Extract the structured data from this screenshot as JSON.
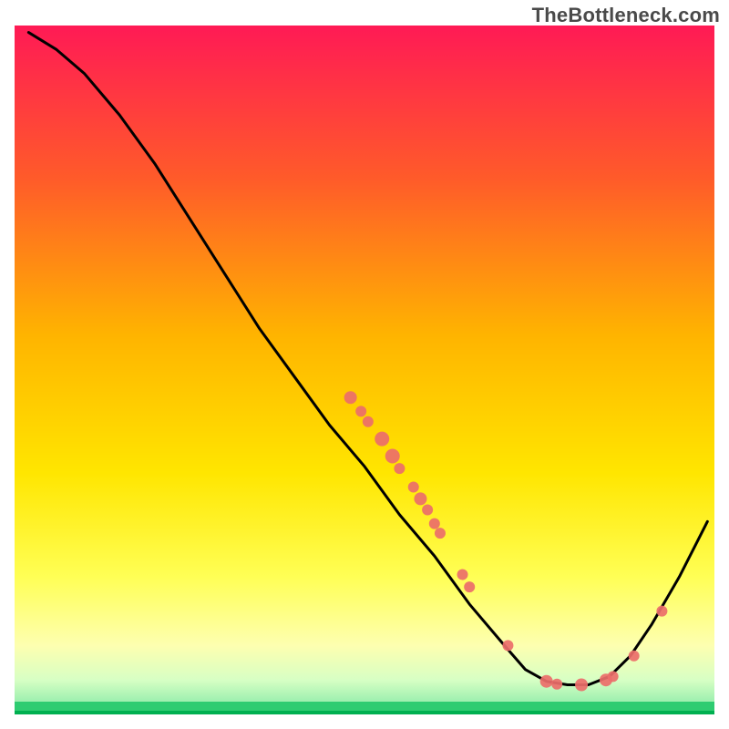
{
  "watermark": "TheBottleneck.com",
  "chart_data": {
    "type": "line",
    "title": "",
    "xlabel": "",
    "ylabel": "",
    "xlim": [
      0,
      100
    ],
    "ylim": [
      0,
      100
    ],
    "background_gradient": {
      "top": "#ff1a55",
      "mid1": "#ff7a00",
      "mid2": "#ffd400",
      "mid3": "#ffff55",
      "mid4": "#e8ffbf",
      "bottom_band": "#2ecc71",
      "bottom_line": "#00b050"
    },
    "curve": [
      {
        "x": 2.0,
        "y": 99.0
      },
      {
        "x": 6.0,
        "y": 96.5
      },
      {
        "x": 10.0,
        "y": 93.0
      },
      {
        "x": 15.0,
        "y": 87.0
      },
      {
        "x": 20.0,
        "y": 80.0
      },
      {
        "x": 25.0,
        "y": 72.0
      },
      {
        "x": 30.0,
        "y": 64.0
      },
      {
        "x": 35.0,
        "y": 56.0
      },
      {
        "x": 40.0,
        "y": 49.0
      },
      {
        "x": 45.0,
        "y": 42.0
      },
      {
        "x": 50.0,
        "y": 36.0
      },
      {
        "x": 55.0,
        "y": 29.0
      },
      {
        "x": 60.0,
        "y": 23.0
      },
      {
        "x": 65.0,
        "y": 16.0
      },
      {
        "x": 70.0,
        "y": 10.0
      },
      {
        "x": 73.0,
        "y": 6.5
      },
      {
        "x": 76.0,
        "y": 4.8
      },
      {
        "x": 79.0,
        "y": 4.3
      },
      {
        "x": 82.0,
        "y": 4.3
      },
      {
        "x": 85.0,
        "y": 5.5
      },
      {
        "x": 88.0,
        "y": 8.5
      },
      {
        "x": 91.0,
        "y": 13.0
      },
      {
        "x": 95.0,
        "y": 20.0
      },
      {
        "x": 99.0,
        "y": 28.0
      }
    ],
    "points": [
      {
        "x": 48.0,
        "y": 46.0,
        "r": 7
      },
      {
        "x": 49.5,
        "y": 44.0,
        "r": 6
      },
      {
        "x": 50.5,
        "y": 42.5,
        "r": 6
      },
      {
        "x": 52.5,
        "y": 40.0,
        "r": 8
      },
      {
        "x": 54.0,
        "y": 37.5,
        "r": 8
      },
      {
        "x": 55.0,
        "y": 35.7,
        "r": 6
      },
      {
        "x": 57.0,
        "y": 33.0,
        "r": 6
      },
      {
        "x": 58.0,
        "y": 31.3,
        "r": 7
      },
      {
        "x": 59.0,
        "y": 29.7,
        "r": 6
      },
      {
        "x": 60.0,
        "y": 27.7,
        "r": 6
      },
      {
        "x": 60.8,
        "y": 26.3,
        "r": 6
      },
      {
        "x": 64.0,
        "y": 20.3,
        "r": 6
      },
      {
        "x": 65.0,
        "y": 18.5,
        "r": 6
      },
      {
        "x": 70.5,
        "y": 10.0,
        "r": 6
      },
      {
        "x": 76.0,
        "y": 4.8,
        "r": 7
      },
      {
        "x": 77.5,
        "y": 4.4,
        "r": 6
      },
      {
        "x": 81.0,
        "y": 4.3,
        "r": 7
      },
      {
        "x": 84.5,
        "y": 5.0,
        "r": 7
      },
      {
        "x": 85.5,
        "y": 5.5,
        "r": 6
      },
      {
        "x": 88.5,
        "y": 8.5,
        "r": 6
      },
      {
        "x": 92.5,
        "y": 15.0,
        "r": 6
      }
    ],
    "point_color": "#ec6e6a",
    "curve_color": "#000000",
    "curve_width": 3.0
  }
}
